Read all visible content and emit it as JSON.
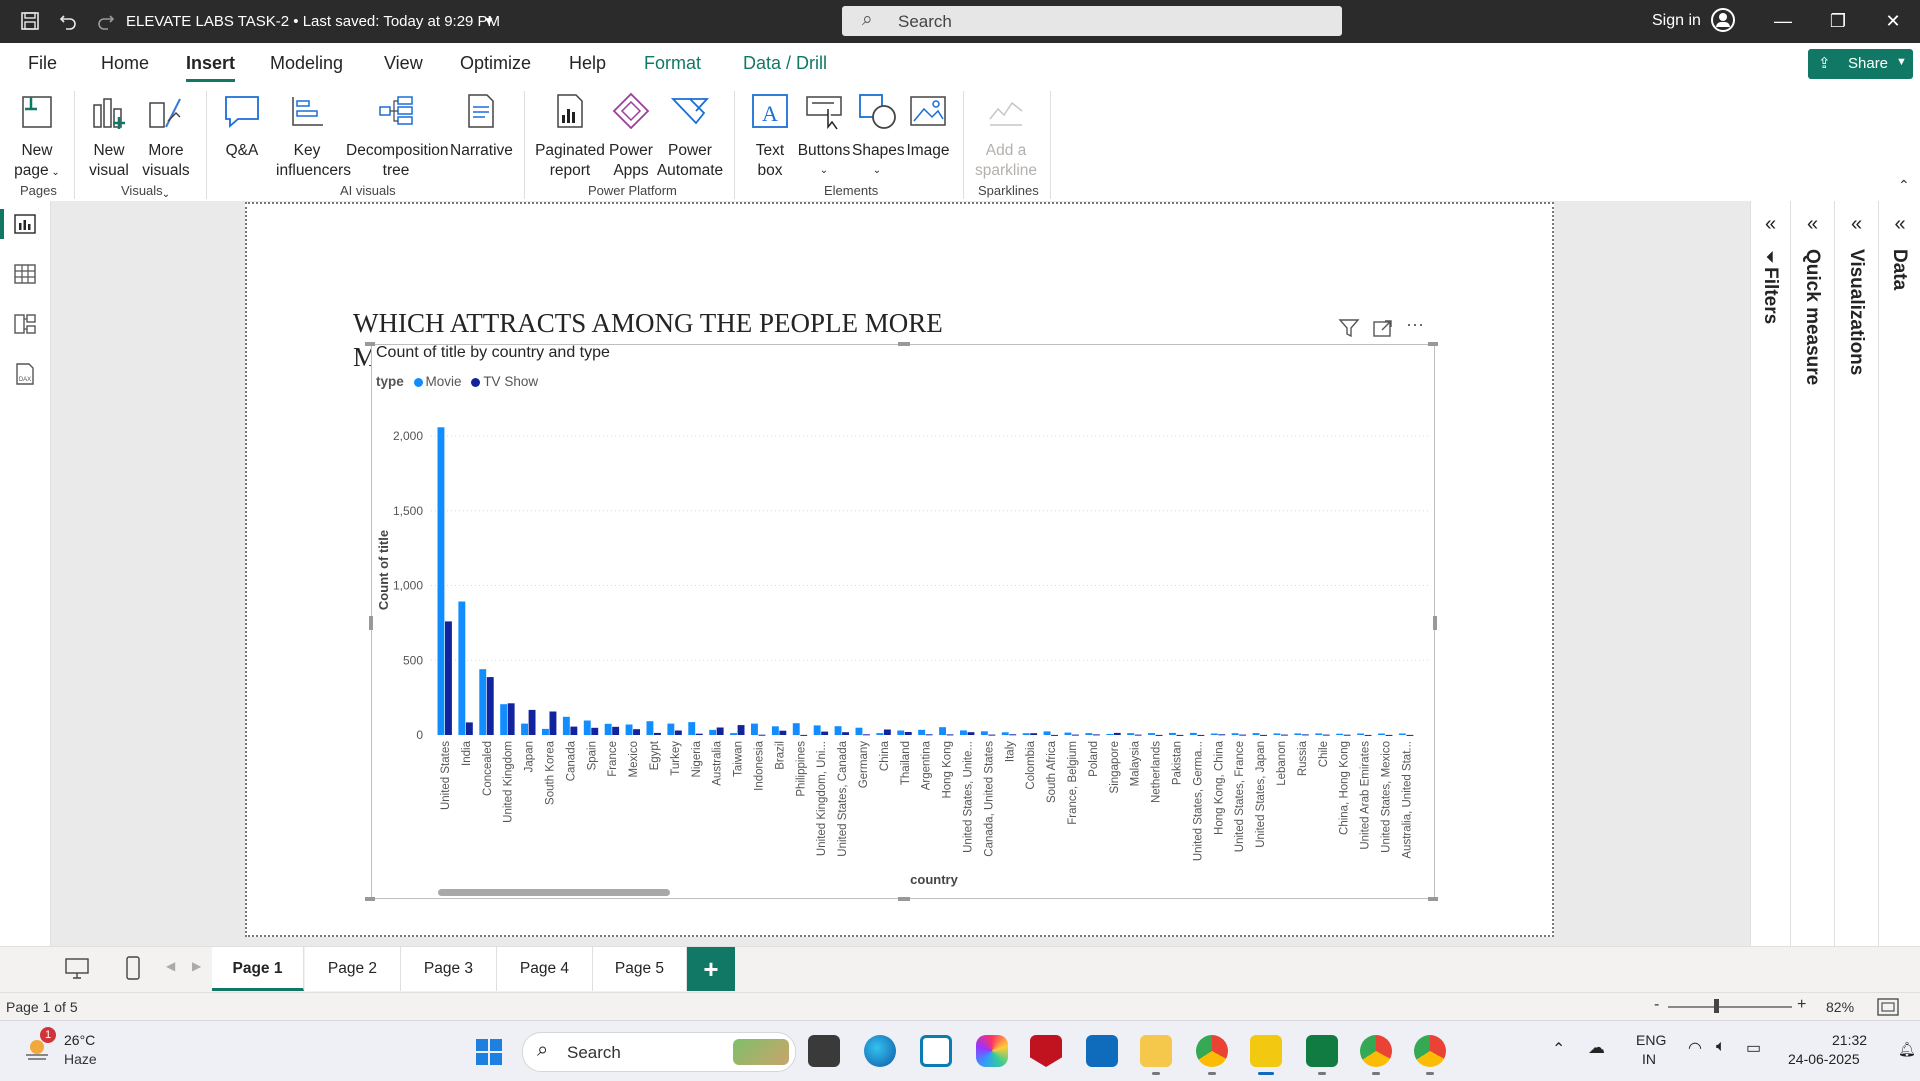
{
  "titlebar": {
    "doc_title": "ELEVATE LABS TASK-2 • Last saved: Today at 9:29 PM",
    "search_placeholder": "Search",
    "sign_in": "Sign in"
  },
  "menu": {
    "tabs": [
      "File",
      "Home",
      "Insert",
      "Modeling",
      "View",
      "Optimize",
      "Help",
      "Format",
      "Data / Drill"
    ],
    "active": "Insert",
    "share_label": "Share"
  },
  "ribbon": {
    "buttons": {
      "new_page": [
        "New",
        "page"
      ],
      "new_visual": [
        "New",
        "visual"
      ],
      "more_visuals": [
        "More",
        "visuals"
      ],
      "qna": [
        "Q&A"
      ],
      "key_influencers": [
        "Key",
        "influencers"
      ],
      "decomposition_tree": [
        "Decomposition",
        "tree"
      ],
      "narrative": [
        "Narrative"
      ],
      "paginated_report": [
        "Paginated",
        "report"
      ],
      "power_apps": [
        "Power",
        "Apps"
      ],
      "power_automate": [
        "Power",
        "Automate"
      ],
      "text_box": [
        "Text",
        "box"
      ],
      "buttons": [
        "Buttons"
      ],
      "shapes": [
        "Shapes"
      ],
      "image": [
        "Image"
      ],
      "add_sparkline": [
        "Add a",
        "sparkline"
      ]
    },
    "groups": {
      "pages": "Pages",
      "visuals": "Visuals",
      "ai_visuals": "AI visuals",
      "power_platform": "Power Platform",
      "elements": "Elements",
      "sparklines": "Sparklines"
    }
  },
  "report": {
    "heading": "WHICH ATTRACTS AMONG THE PEOPLE MORE",
    "heading_line2": "M"
  },
  "colors": {
    "movie": "#118DFF",
    "tv_show": "#12239E",
    "accent": "#117865"
  },
  "chart_data": {
    "type": "bar",
    "title": "Count of title by country and type",
    "legend_title": "type",
    "legend_placement": "top-left",
    "xlabel": "country",
    "ylabel": "Count of title",
    "ylim": [
      0,
      2000
    ],
    "yticks": [
      "0",
      "500",
      "1,000",
      "1,500",
      "2,000"
    ],
    "grid": true,
    "categories": [
      "United States",
      "India",
      "Concealed",
      "United Kingdom",
      "Japan",
      "South Korea",
      "Canada",
      "Spain",
      "France",
      "Mexico",
      "Egypt",
      "Turkey",
      "Nigeria",
      "Australia",
      "Taiwan",
      "Indonesia",
      "Brazil",
      "Philippines",
      "United Kingdom, Uni...",
      "United States, Canada",
      "Germany",
      "China",
      "Thailand",
      "Argentina",
      "Hong Kong",
      "United States, Unite...",
      "Canada, United States",
      "Italy",
      "Colombia",
      "South Africa",
      "France, Belgium",
      "Poland",
      "Singapore",
      "Malaysia",
      "Netherlands",
      "Pakistan",
      "United States, Germa...",
      "Hong Kong, China",
      "United States, France",
      "United States, Japan",
      "Lebanon",
      "Russia",
      "Chile",
      "China, Hong Kong",
      "United Arab Emirates",
      "United States, Mexico",
      "Australia, United Stat..."
    ],
    "series": [
      {
        "name": "Movie",
        "values": [
          2058,
          893,
          440,
          206,
          76,
          41,
          122,
          97,
          75,
          70,
          92,
          76,
          86,
          34,
          13,
          76,
          58,
          79,
          64,
          59,
          49,
          13,
          30,
          35,
          52,
          31,
          25,
          18,
          12,
          24,
          16,
          13,
          7,
          13,
          13,
          14,
          14,
          10,
          12,
          13,
          11,
          11,
          11,
          9,
          10,
          10,
          10
        ]
      },
      {
        "name": "TV Show",
        "values": [
          760,
          84,
          387,
          212,
          168,
          157,
          56,
          48,
          55,
          39,
          14,
          30,
          9,
          50,
          66,
          2,
          29,
          1,
          23,
          19,
          5,
          37,
          20,
          5,
          4,
          19,
          3,
          5,
          12,
          1,
          3,
          4,
          14,
          3,
          1,
          1,
          1,
          5,
          3,
          1,
          3,
          4,
          3,
          2,
          1,
          1,
          1
        ]
      }
    ]
  },
  "pages": {
    "tabs": [
      "Page 1",
      "Page 2",
      "Page 3",
      "Page 4",
      "Page 5"
    ],
    "active": "Page 1",
    "add_label": "+"
  },
  "panes": {
    "filters": "Filters",
    "quick_measure": "Quick measure",
    "visualizations": "Visualizations",
    "data": "Data"
  },
  "status": {
    "page_indicator": "Page 1 of 5",
    "zoom": "82%"
  },
  "taskbar": {
    "weather_temp": "26°C",
    "weather_desc": "Haze",
    "weather_badge": "1",
    "search_label": "Search",
    "lang_line1": "ENG",
    "lang_line2": "IN",
    "time": "21:32",
    "date": "24-06-2025"
  }
}
